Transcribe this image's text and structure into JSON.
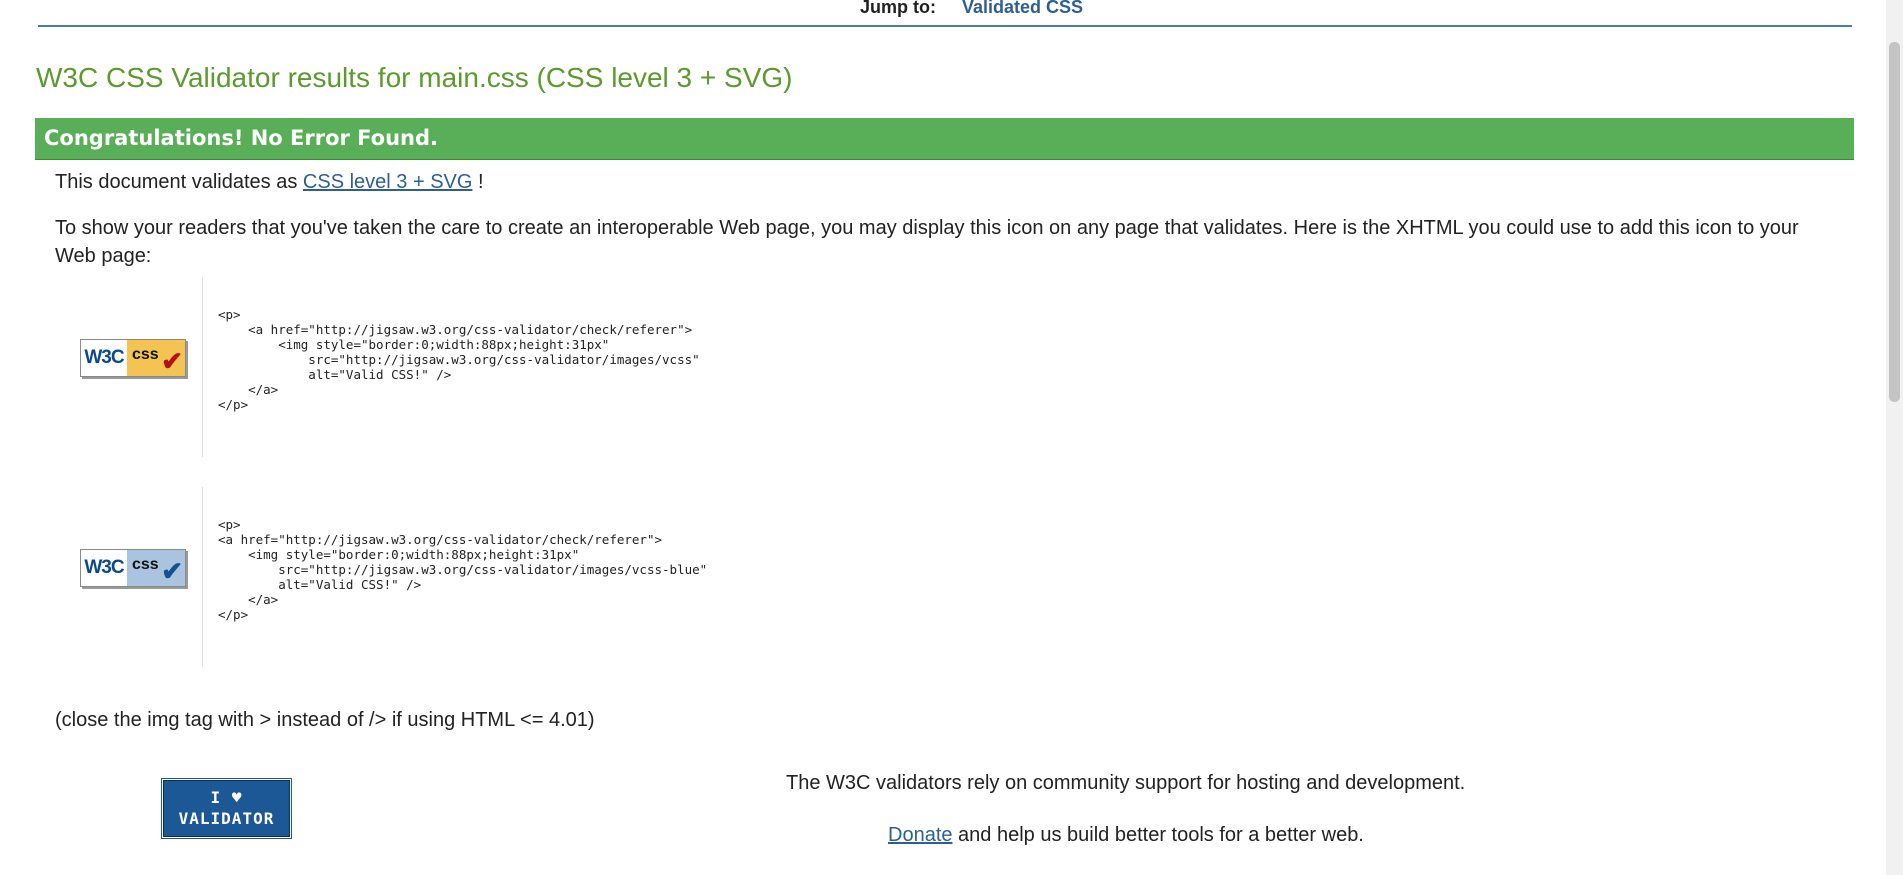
{
  "nav": {
    "jump_label": "Jump to:",
    "jump_link": "Validated CSS"
  },
  "title": "W3C CSS Validator results for main.css (CSS level 3 + SVG)",
  "banner": "Congratulations! No Error Found.",
  "validates": {
    "prefix": "This document validates as",
    "link": "CSS level 3 + SVG",
    "suffix": " !"
  },
  "readers_text": "To show your readers that you've taken the care to create an interoperable Web page, you may display this icon on any page that validates. Here is the XHTML you could use to add this icon to your Web page:",
  "badges": {
    "w3c": "W3C",
    "css": "css",
    "check": "✔",
    "gold_color": "#f3c451",
    "blue_color": "#aac3df"
  },
  "code_gold": "<p>\n    <a href=\"http://jigsaw.w3.org/css-validator/check/referer\">\n        <img style=\"border:0;width:88px;height:31px\"\n            src=\"http://jigsaw.w3.org/css-validator/images/vcss\"\n            alt=\"Valid CSS!\" />\n    </a>\n</p>",
  "code_blue": "<p>\n<a href=\"http://jigsaw.w3.org/css-validator/check/referer\">\n    <img style=\"border:0;width:88px;height:31px\"\n        src=\"http://jigsaw.w3.org/css-validator/images/vcss-blue\"\n        alt=\"Valid CSS!\" />\n    </a>\n</p>",
  "close_note": "(close the img tag with > instead of /> if using HTML <= 4.01)",
  "ilove": {
    "top": "I ♥",
    "bottom": "VALIDATOR"
  },
  "support": {
    "text": "The W3C validators rely on community support for hosting and development.",
    "donate_link": "Donate",
    "donate_suffix": " and help us build better tools for a better web."
  }
}
